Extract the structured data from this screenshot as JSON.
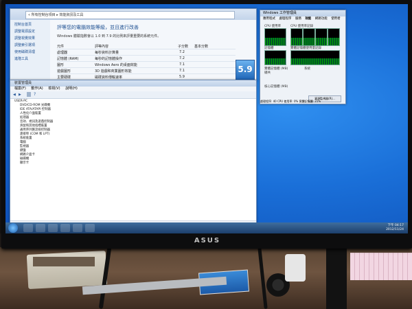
{
  "perf_window": {
    "address": "« 所有控制台項目 ▸ 效能資訊及工具",
    "sidebar": [
      "控制台首頁",
      "調整電源設定",
      "調整視覺效果",
      "調整索引選項",
      "使用磁碟清理",
      "進階工具"
    ],
    "title": "評等您的電腦效能等級，並且進行改善",
    "description": "Windows 體驗指數會以 1.0 到 7.9 的比例來評量重要的系統元件。",
    "columns": [
      "元件",
      "評等內容",
      "子分數",
      "基本分數"
    ],
    "rows": [
      {
        "component": "處理器",
        "detail": "每秒資料計算量",
        "score": "7.2"
      },
      {
        "component": "記憶體 (RAM)",
        "detail": "每秒的記憶體操作",
        "score": "7.2"
      },
      {
        "component": "圖形",
        "detail": "Windows Aero 的桌面效能",
        "score": "7.1"
      },
      {
        "component": "遊戲圖形",
        "detail": "3D 遊戲和商業圖形效能",
        "score": "7.1"
      },
      {
        "component": "主要硬碟",
        "detail": "磁碟資料傳輸速率",
        "score": "5.9"
      }
    ],
    "base_score": "5.9"
  },
  "device_manager": {
    "title": "裝置管理員",
    "menu": [
      "檔案(F)",
      "動作(A)",
      "檢視(V)",
      "說明(H)"
    ],
    "tree": [
      "USER-PC",
      "DVD/CD-ROM 光碟機",
      "IDE ATA/ATAPI 控制器",
      "人性化介面裝置",
      "処理器",
      "音效、視訊及遊戲控制器",
      "滑鼠和其他指標裝置",
      "通用序列匯流排控制器",
      "連接埠 (COM 和 LPT)",
      "系統裝置",
      "電腦",
      "監視器",
      "鍵盤",
      "網路介面卡",
      "磁碟機",
      "顯示卡"
    ]
  },
  "task_manager": {
    "title": "Windows 工作管理員",
    "tabs": [
      "應用程式",
      "處理程序",
      "服務",
      "效能",
      "網路功能",
      "使用者"
    ],
    "cpu_label": "CPU 使用率",
    "cpu_history_label": "CPU 使用率記錄",
    "mem_label": "記憶體",
    "mem_history_label": "實體記憶體使用量記錄",
    "phys_mem_label": "實體記憶體 (MB)",
    "total_label": "總共",
    "kernel_label": "核心記憶體 (MB)",
    "system_label": "系統",
    "resource_button": "資源監視器(R)...",
    "status": "處理程序: 40    CPU 使用率: 0%    實體記憶體: 21%"
  },
  "taskbar": {
    "time": "下午 04:17",
    "date": "2012/11/24"
  },
  "monitor": {
    "brand": "ASUS"
  }
}
